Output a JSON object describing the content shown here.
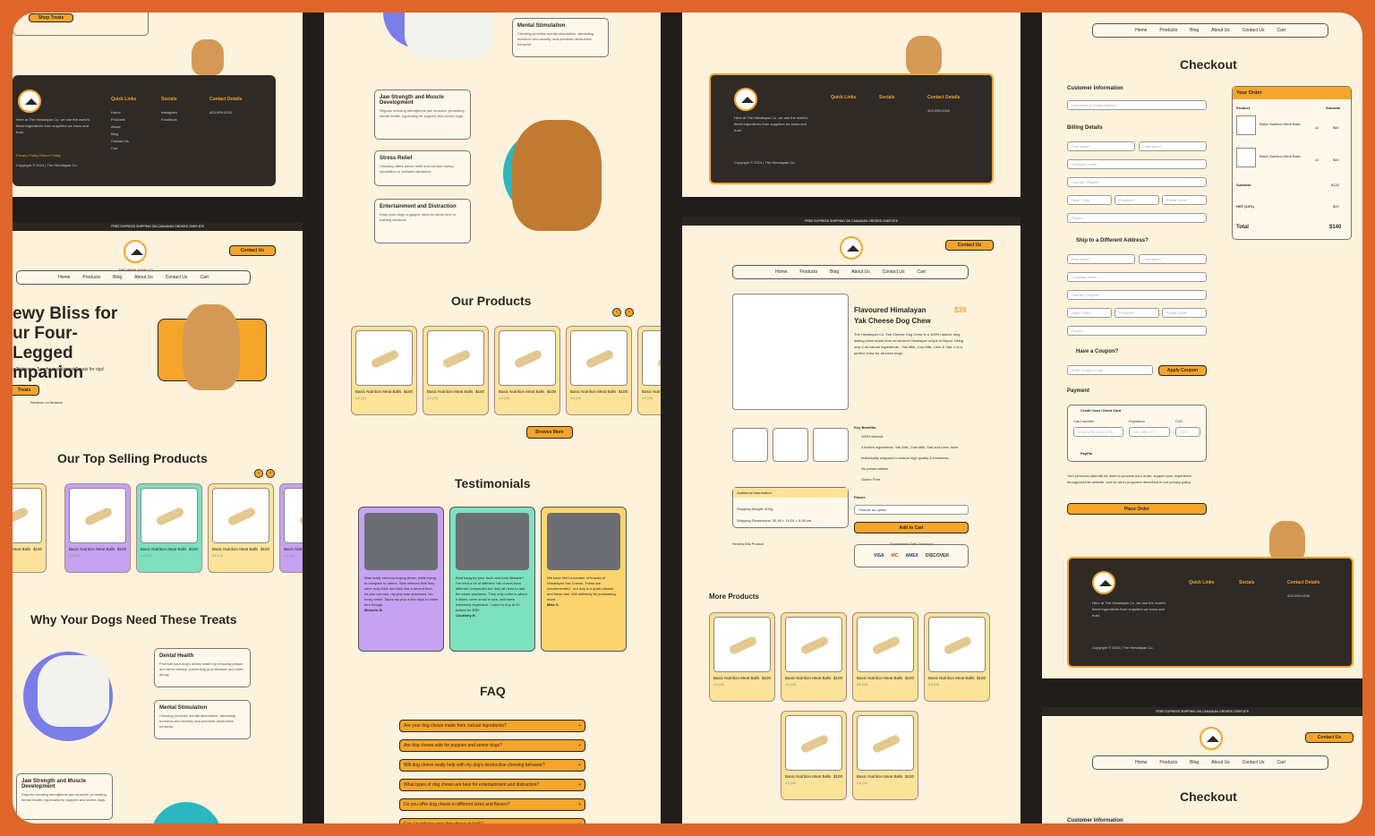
{
  "footer": {
    "quick": "Quick Links",
    "socials": "Socials",
    "contact": "Contact Details",
    "links": [
      "Home",
      "Products",
      "About",
      "Blog",
      "Contact Us",
      "Cart"
    ],
    "social_links": [
      "Instagram",
      "Facebook"
    ],
    "phone": "403-999-0326",
    "about": "Here at The Himalayan Co. we use the world's finest ingredients from suppliers we know and trust.",
    "legal": "Privacy Policy   Return Policy",
    "copy": "Copyright © 2024 | The Himalayan Co."
  },
  "shop_treats": "Shop Treats",
  "strip": "FREE EXPRESS SHIPPING ON CANADIAN ORDERS OVER $75",
  "brand": "THE HIMALAYAN CO.",
  "contact_btn": "Contact Us",
  "nav": [
    "Home",
    "Products",
    "Blog",
    "About Us",
    "Contact Us",
    "Cart"
  ],
  "hero": {
    "title": "ewy Bliss for ur Four-Legged mpanion",
    "sub": "y Delicious, Tough, and Natural Treats for ogs!",
    "cta": "Treats",
    "reviews": "Reviews on Amazon"
  },
  "top_selling": "Our Top Selling Products",
  "product": {
    "name": "Basic Nutrition Meat Balls",
    "price": "$100",
    "rating": "4.5 (19)"
  },
  "why": "Why Your Dogs Need These Treats",
  "benefits": [
    {
      "t": "Dental Health",
      "d": "Promote your dog's dental health by reducing plaque and tartar buildup, preventing gum disease and tooth decay."
    },
    {
      "t": "Mental Stimulation",
      "d": "Chewing provides mental stimulation, alleviating boredom and anxiety, and prevents destructive behavior."
    },
    {
      "t": "Jaw Strength and Muscle Development",
      "d": "Regular chewing strengthens jaw muscles, promoting dental health, especially for puppies and senior dogs."
    },
    {
      "t": "Stress Relief",
      "d": "Chewing offers stress relief and comfort during separation or stressful situations."
    },
    {
      "t": "Entertainment and Distraction",
      "d": "Keep your dogs engaged, ideal for alone time or training sessions."
    }
  ],
  "our_products": "Our Products",
  "browse": "Browse More",
  "testimonials": "Testimonials",
  "testi": [
    {
      "q": "Was really nervous buying these, while trying to compare to others. Was relieved that they were truly thick and they last a decent time. As you can see, my pup was obsessed. No funky smell. Takes my pup a few days to chew thru though.",
      "a": "Michelle B."
    },
    {
      "q": "Best bang for your buck and total lifesaver! I've tried a lot of different Yak chews from different companies but they all need to last the same problems. They only come in about 4 sticks, were small in size, and were extremely expensive. I used to buy at 20 dollars for $30!",
      "a": "Courtney H."
    },
    {
      "q": "We have tried a number of brands of Himalayan Yak Chews. These are recommended - our dog is a quick chewer and these last. Will definitely be purchasing more.",
      "a": "Mike S."
    }
  ],
  "faq_title": "FAQ",
  "faq": [
    "Are your dog chews made from natural ingredients?",
    "Are dog chews safe for puppies and senior dogs?",
    "Will dog chews really help with my dog's destructive chewing behavior?",
    "What types of dog chews are best for entertainment and distraction?",
    "Do you offer dog chews in different sizes and flavors?",
    "Can I purchase your dog chews in bulk?"
  ],
  "pd": {
    "title1": "Flavoured Himalayan",
    "title2": "Yak Cheese Dog Chew",
    "price": "$39",
    "desc": "The Himalayan Co. Yak Cheese Dog Chew is a 100% natural, long lasting chew made from an ancient Himalayan recipe in Nepal. Using only 4 all natural ingredients - Yak Milk, Cow Milk, Lime & Salt, it is a perfect chew for all sized dogs.",
    "kb": "Key Benefits:",
    "benefits": [
      "100% Natural.",
      "4 limited ingredients: Yak Milk, Cow Milk, Salt and Lime Juice.",
      "Individually wrapped to ensure high quality & freshness.",
      "No preservatives.",
      "Gluten Free."
    ],
    "add_info": "Additional Information:",
    "weight": "Shipping Weight: 600g",
    "dims": "Shipping Dimensions: 30.48 × 15.24 × 5.08 cm",
    "flavor": "Flavor:",
    "choose": "Choose an option",
    "add": "Add to Cart",
    "guaranteed": "Guaranteed Safe Checkout",
    "review": "Review this Product",
    "more": "More Products",
    "cards": [
      "VISA",
      "MC",
      "AMEX",
      "DISCOVER"
    ]
  },
  "checkout": {
    "title": "Checkout",
    "ci": "Customer Information",
    "email": "Username or Email Address*",
    "billing": "Billing Details",
    "first": "First name*",
    "last": "Last name*",
    "company": "Company name",
    "country": "Country / Region*",
    "town": "Town / City*",
    "province": "Province*",
    "postal": "Postal Code*",
    "phone": "Phone*",
    "ship": "Ship to a Different Address?",
    "coupon_q": "Have a Coupon?",
    "coupon": "Enter Coupon Code",
    "apply": "Apply Coupon",
    "payment": "Payment",
    "cc": "Credit Card / Debit Card",
    "card_no": "Card number",
    "card_ph": "1234 1234 1234 1234",
    "exp": "Expiration",
    "exp_ph": "DD / MM / YY",
    "cvc": "CVC",
    "paypal": "PayPal",
    "privacy": "Your personal data will be used to process your order, support your experience throughout this website, and for other purposes described in our privacy policy.",
    "place": "Place Order",
    "order": "Your Order",
    "product": "Product",
    "subtotal": "Subtotal",
    "item": "Basic Nutrition Meat Balls",
    "qty": "x2",
    "line": "$60",
    "sub_v": "$120",
    "hst": "HST (13%)",
    "hst_v": "$20",
    "total": "Total",
    "total_v": "$140"
  }
}
